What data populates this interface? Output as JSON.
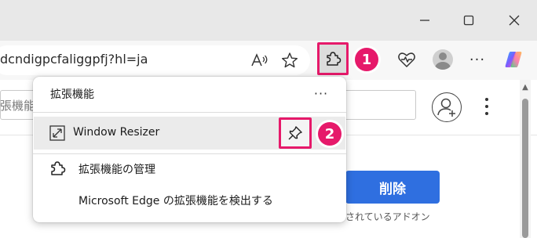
{
  "window": {
    "minimize_label": "—",
    "maximize_label": "☐",
    "close_label": "✕"
  },
  "address_bar": {
    "url_text": "dcndigpcfaliggpfj?hl=ja",
    "read_aloud_label": "A̧"
  },
  "toolbar": {
    "extensions_badge": "1",
    "more_label": "···"
  },
  "page": {
    "search_text": "張機能",
    "delete_label": "削除",
    "addon_note": "されているアドオン"
  },
  "extensions_panel": {
    "title": "拡張機能",
    "more_label": "···",
    "pinned_row": {
      "label": "Window Resizer",
      "pin_badge": "2"
    },
    "items": [
      {
        "label": "拡張機能の管理"
      },
      {
        "label": "Microsoft Edge の拡張機能を検出する"
      }
    ]
  },
  "colors": {
    "highlight": "#e6196a",
    "primary_button": "#2f6fe0",
    "titlebar": "#e8e8e8"
  }
}
